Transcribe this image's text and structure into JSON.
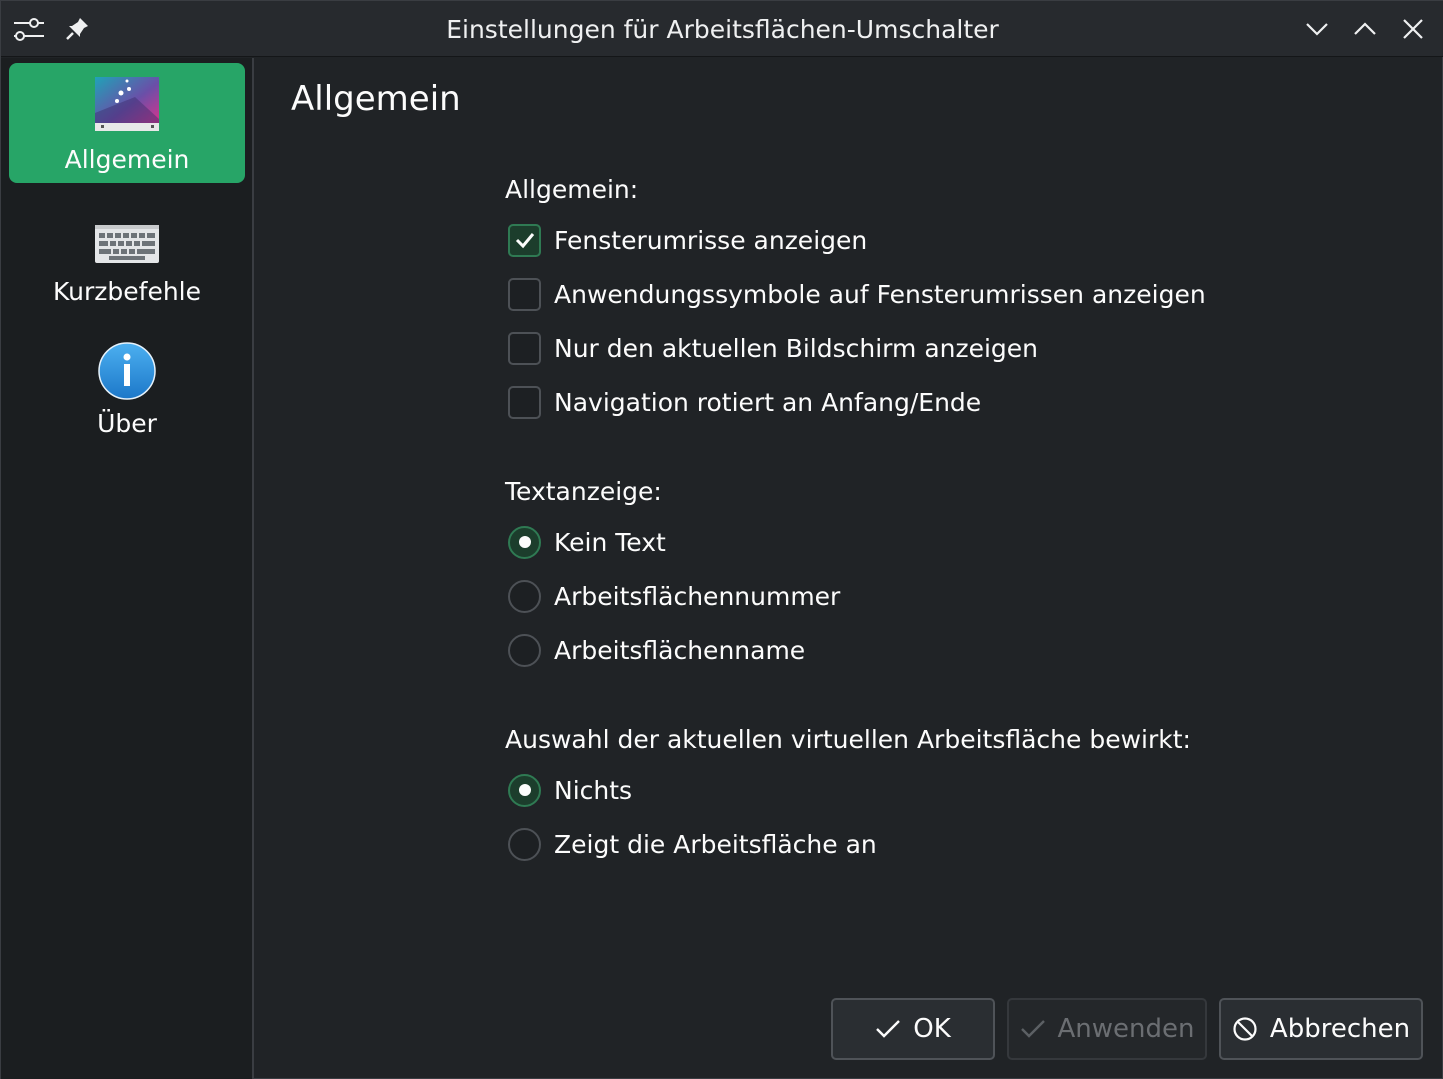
{
  "window": {
    "title": "Einstellungen für Arbeitsflächen-Umschalter"
  },
  "sidebar": {
    "items": [
      {
        "label": "Allgemein",
        "icon": "desktop-pager-icon",
        "active": true
      },
      {
        "label": "Kurzbefehle",
        "icon": "keyboard-icon",
        "active": false
      },
      {
        "label": "Über",
        "icon": "info-icon",
        "active": false
      }
    ]
  },
  "main": {
    "page_title": "Allgemein",
    "general": {
      "label": "Allgemein:",
      "options": [
        {
          "label": "Fensterumrisse anzeigen",
          "checked": true
        },
        {
          "label": "Anwendungssymbole auf Fensterumrissen anzeigen",
          "checked": false
        },
        {
          "label": "Nur den aktuellen Bildschirm anzeigen",
          "checked": false
        },
        {
          "label": "Navigation rotiert an Anfang/Ende",
          "checked": false
        }
      ]
    },
    "text_display": {
      "label": "Textanzeige:",
      "options": [
        {
          "label": "Kein Text",
          "selected": true
        },
        {
          "label": "Arbeitsflächennummer",
          "selected": false
        },
        {
          "label": "Arbeitsflächenname",
          "selected": false
        }
      ]
    },
    "selection": {
      "label": "Auswahl der aktuellen virtuellen Arbeitsfläche bewirkt:",
      "options": [
        {
          "label": "Nichts",
          "selected": true
        },
        {
          "label": "Zeigt die Arbeitsfläche an",
          "selected": false
        }
      ]
    }
  },
  "footer": {
    "ok_label": "OK",
    "apply_label": "Anwenden",
    "cancel_label": "Abbrechen"
  },
  "colors": {
    "accent": "#27a567",
    "background": "#202326",
    "sidebar": "#1b1e20"
  }
}
